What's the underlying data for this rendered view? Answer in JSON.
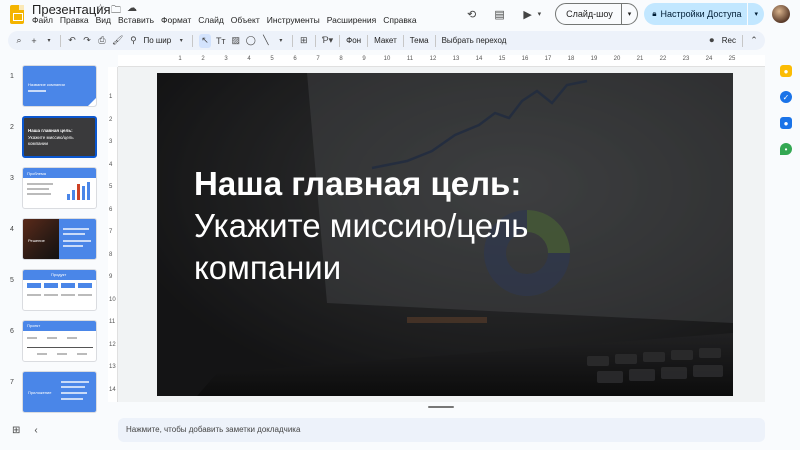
{
  "app": {
    "title": "Презентация",
    "menu": [
      "Файл",
      "Правка",
      "Вид",
      "Вставить",
      "Формат",
      "Слайд",
      "Объект",
      "Инструменты",
      "Расширения",
      "Справка"
    ],
    "slideshow_label": "Слайд-шоу",
    "share_label": "Настройки Доступа"
  },
  "toolbar": {
    "zoom_label": "По шир",
    "background_label": "Фон",
    "layout_label": "Макет",
    "theme_label": "Тема",
    "transition_label": "Выбрать переход",
    "rec_label": "Rec"
  },
  "filmstrip": {
    "numbers": [
      "1",
      "2",
      "3",
      "4",
      "5",
      "6",
      "7"
    ],
    "selected_index": 2,
    "thumb1_title": "Название компании",
    "thumb2_title": "Наша главная цель:",
    "thumb2_sub1": "Укажите миссию/цель",
    "thumb2_sub2": "компании",
    "thumb3_title": "Проблема",
    "thumb4_title": "Решение",
    "thumb5_title": "Продукт",
    "thumb6_title": "Проект",
    "thumb7_title": "Приложение"
  },
  "rulers": {
    "horizontal": [
      "1",
      "2",
      "3",
      "4",
      "5",
      "6",
      "7",
      "8",
      "9",
      "10",
      "11",
      "12",
      "13",
      "14",
      "15",
      "16",
      "17",
      "18",
      "19",
      "20",
      "21",
      "22",
      "23",
      "24",
      "25"
    ],
    "vertical": [
      "1",
      "2",
      "3",
      "4",
      "5",
      "6",
      "7",
      "8",
      "9",
      "10",
      "11",
      "12",
      "13",
      "14"
    ]
  },
  "slide": {
    "title_bold": "Наша главная цель:",
    "title_line2": "Укажите миссию/цель",
    "title_line3": "компании"
  },
  "notes": {
    "placeholder": "Нажмите, чтобы добавить заметки докладчика"
  },
  "colors": {
    "accent": "#0b57d0",
    "share_bg": "#c2e7ff",
    "slide_blue": "#4a86e8",
    "toolbar_bg": "#edf2fa"
  }
}
